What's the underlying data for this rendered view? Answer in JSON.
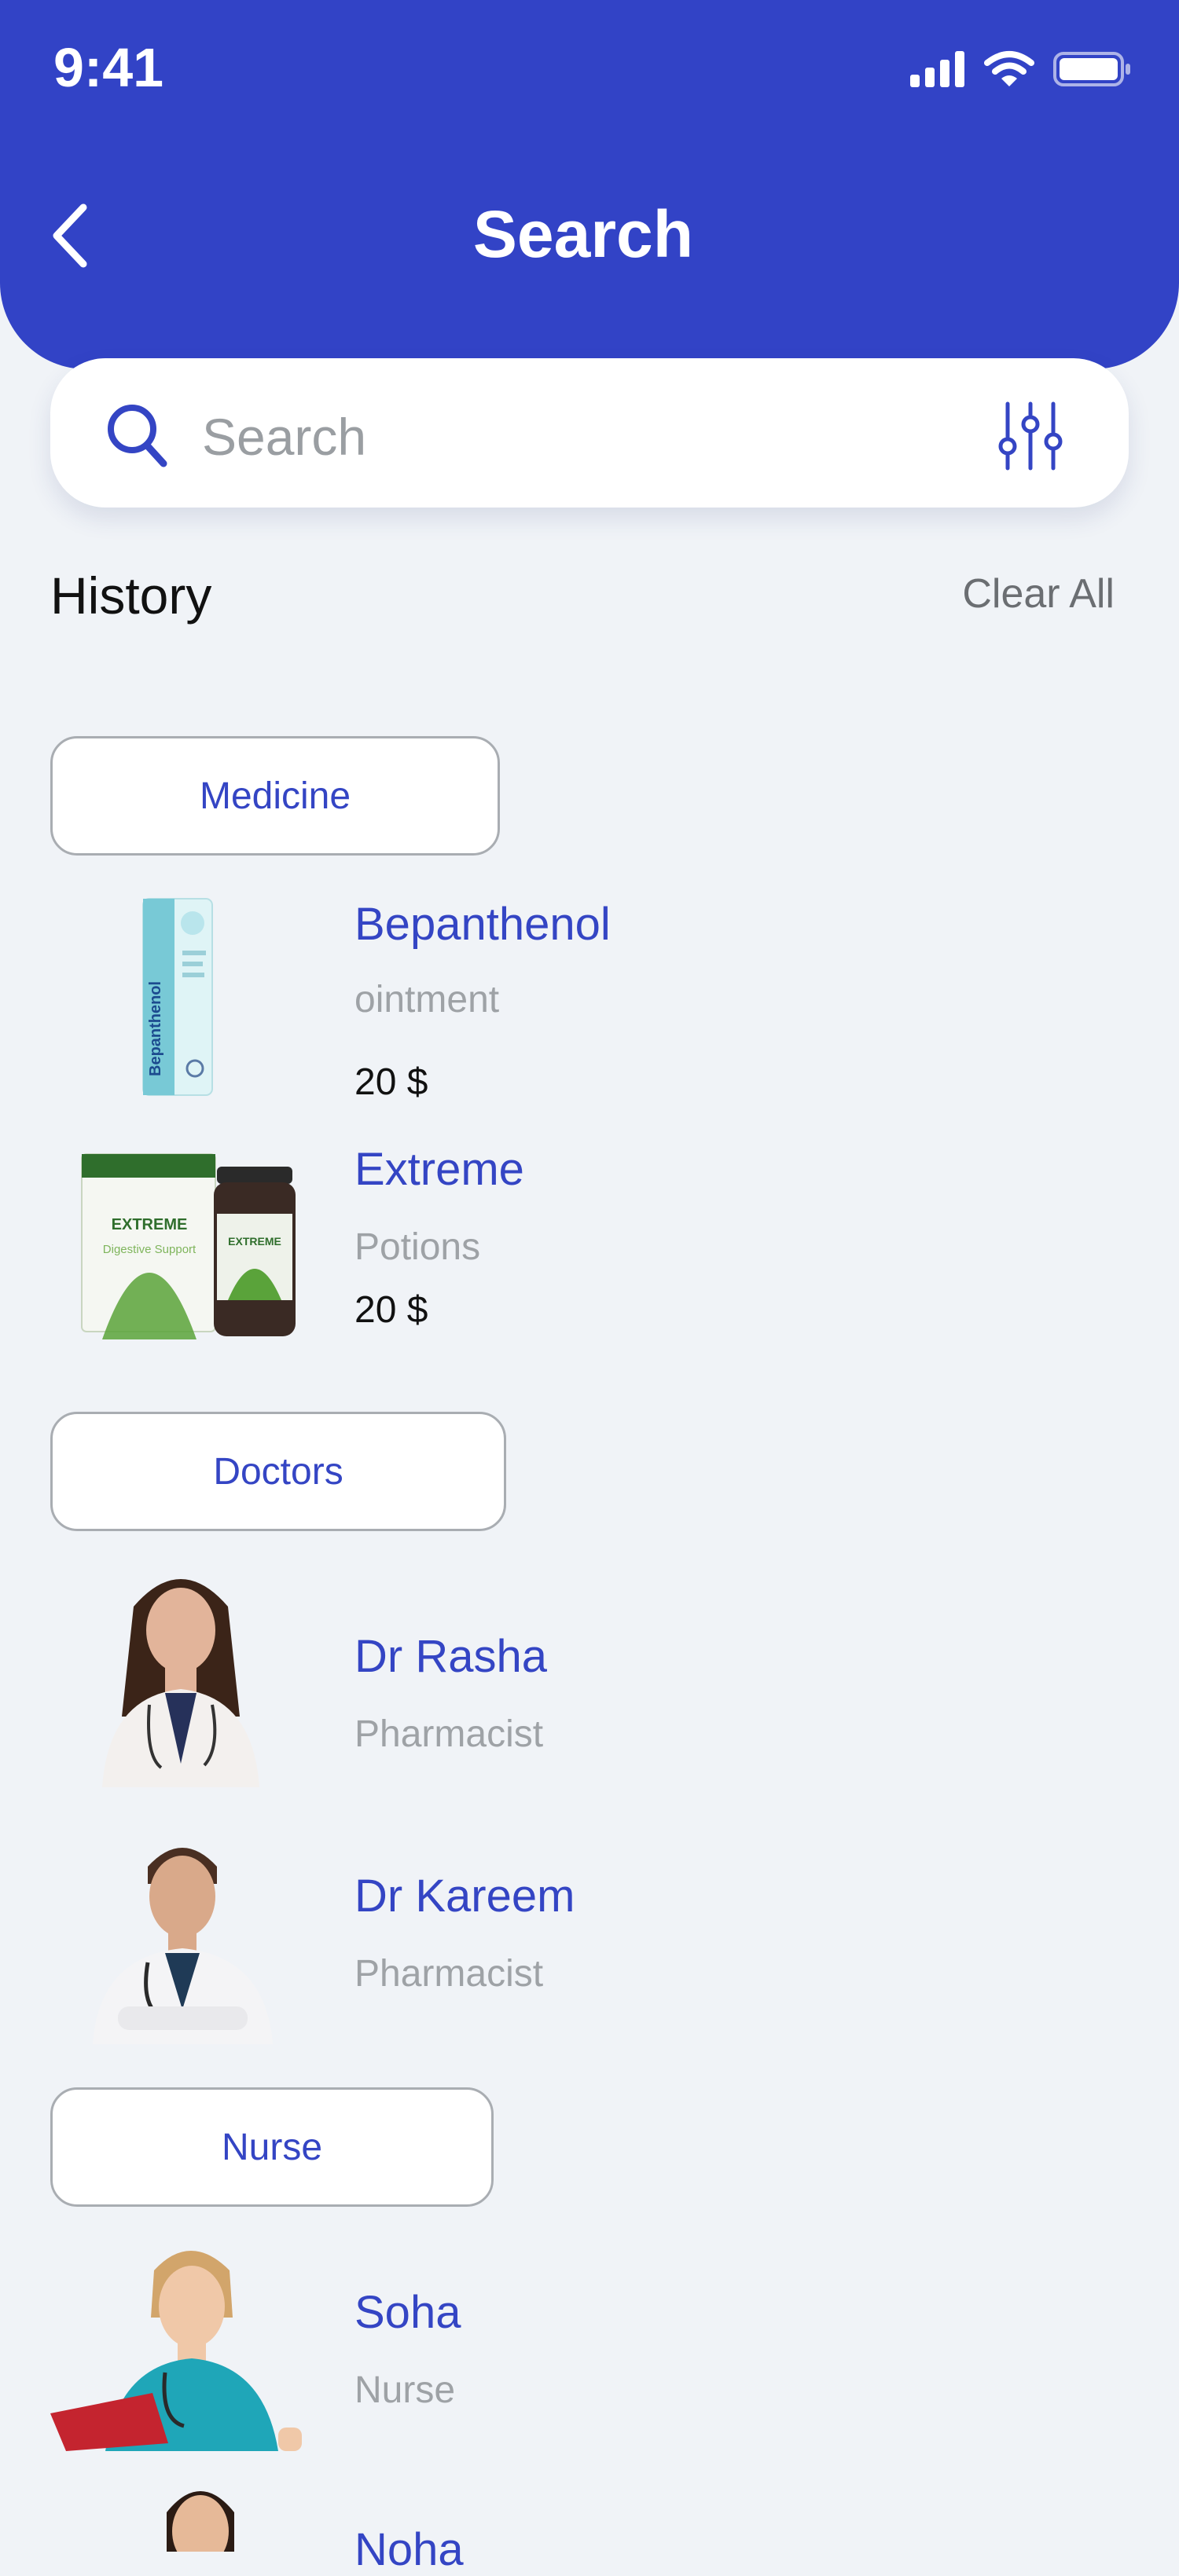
{
  "status": {
    "time": "9:41"
  },
  "header": {
    "title": "Search"
  },
  "search": {
    "placeholder": "Search"
  },
  "history": {
    "title": "History",
    "clear_label": "Clear All"
  },
  "categories": {
    "medicine": "Medicine",
    "doctors": "Doctors",
    "nurse": "Nurse"
  },
  "medicines": [
    {
      "name": "Bepanthenol",
      "type": "ointment",
      "price": "20 $"
    },
    {
      "name": "Extreme",
      "type": "Potions",
      "price": "20 $"
    }
  ],
  "doctors": [
    {
      "name": "Dr Rasha",
      "role": "Pharmacist"
    },
    {
      "name": "Dr Kareem",
      "role": "Pharmacist"
    }
  ],
  "nurses": [
    {
      "name": "Soha",
      "role": "Nurse"
    },
    {
      "name": "Noha",
      "role": ""
    }
  ],
  "colors": {
    "primary": "#3243c6",
    "background": "#f0f3f7",
    "muted": "#9ea2a6"
  }
}
